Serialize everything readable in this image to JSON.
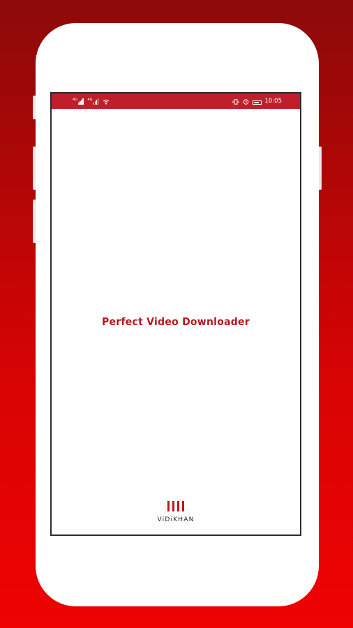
{
  "status_bar": {
    "sim1_tag": "4G",
    "sim2_tag": "4G",
    "time": "10:05",
    "icons": [
      "signal-icon",
      "signal-icon",
      "wifi-icon",
      "vibrate-icon",
      "alarm-icon",
      "battery-icon"
    ]
  },
  "splash": {
    "app_title": "Perfect Video Downloader",
    "brand_name": "ViDiKHAN"
  },
  "colors": {
    "background_top": "#8c0a0a",
    "background_bottom": "#ee0202",
    "status_bar": "#be1f2a",
    "title_text": "#b8161f",
    "brand_mark": "#c0141e"
  }
}
